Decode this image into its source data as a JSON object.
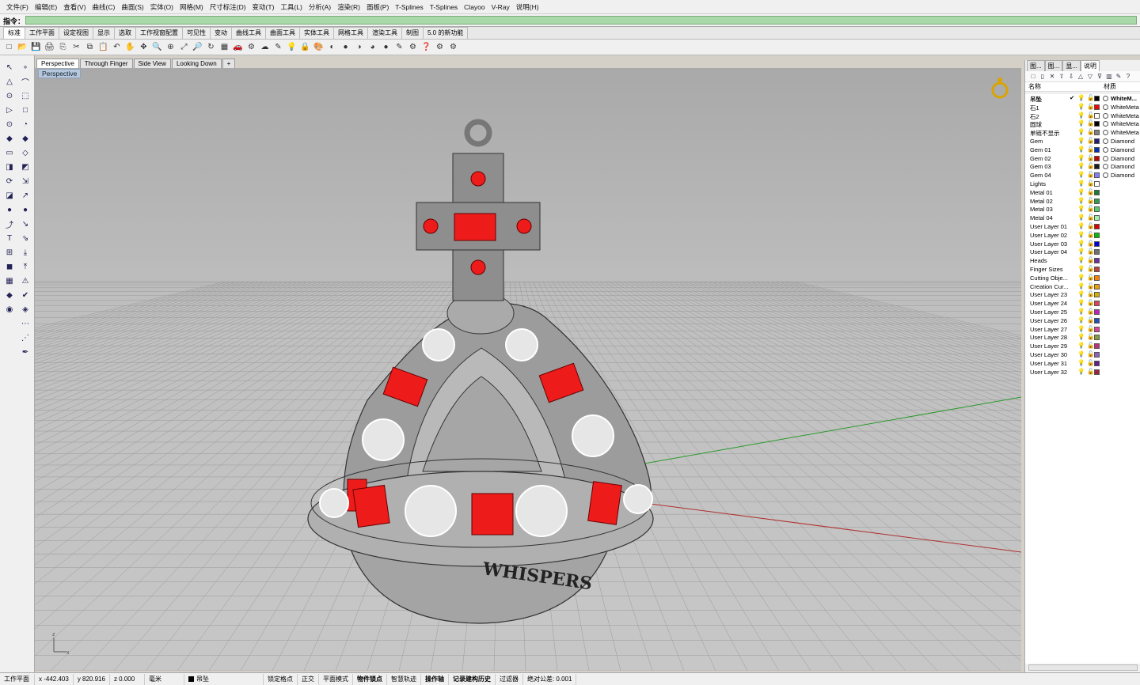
{
  "menu": [
    "文件(F)",
    "编辑(E)",
    "查看(V)",
    "曲线(C)",
    "曲面(S)",
    "实体(O)",
    "网格(M)",
    "尺寸标注(D)",
    "变动(T)",
    "工具(L)",
    "分析(A)",
    "渲染(R)",
    "面板(P)",
    "T-Splines",
    "T-Splines",
    "Clayoo",
    "V-Ray",
    "说明(H)"
  ],
  "command": {
    "label": "指令："
  },
  "toolbar_tabs": [
    "标准",
    "工作平面",
    "设定视图",
    "显示",
    "选取",
    "工作视窗配置",
    "可见性",
    "变动",
    "曲线工具",
    "曲面工具",
    "实体工具",
    "网格工具",
    "渲染工具",
    "制图",
    "5.0 的新功能"
  ],
  "viewport_tabs": [
    "Perspective",
    "Through Finger",
    "Side View",
    "Looking Down"
  ],
  "viewport": {
    "label": "Perspective",
    "engraving": "WHISPERS"
  },
  "panel_tabs": [
    "图...",
    "图...",
    "显...",
    "说明"
  ],
  "layer_headers": {
    "name": "名称",
    "material": "材质"
  },
  "layers": [
    {
      "name": "吊坠",
      "check": "✔",
      "color": "#000000",
      "material": "WhiteM...",
      "bold": true
    },
    {
      "name": "石1",
      "check": "",
      "color": "#ff0000",
      "material": "WhiteMeta"
    },
    {
      "name": "石2",
      "check": "",
      "color": "#ffffff",
      "material": "WhiteMeta"
    },
    {
      "name": "圆球",
      "check": "",
      "color": "#000000",
      "material": "WhiteMeta"
    },
    {
      "name": "单链不显示",
      "check": "",
      "color": "#808080",
      "material": "WhiteMeta"
    },
    {
      "name": "Gem",
      "check": "",
      "color": "#1f1f7a",
      "material": "Diamond"
    },
    {
      "name": "Gem 01",
      "check": "",
      "color": "#0030c0",
      "material": "Diamond"
    },
    {
      "name": "Gem 02",
      "check": "",
      "color": "#cc0000",
      "material": "Diamond"
    },
    {
      "name": "Gem 03",
      "check": "",
      "color": "#1a1a1a",
      "material": "Diamond"
    },
    {
      "name": "Gem 04",
      "check": "",
      "color": "#8080ff",
      "material": "Diamond"
    },
    {
      "name": "Lights",
      "check": "",
      "color": "#ffffff",
      "material": ""
    },
    {
      "name": "Metal 01",
      "check": "",
      "color": "#1a7a3a",
      "material": ""
    },
    {
      "name": "Metal 02",
      "check": "",
      "color": "#2e9e4e",
      "material": ""
    },
    {
      "name": "Metal 03",
      "check": "",
      "color": "#4fcf6f",
      "material": ""
    },
    {
      "name": "Metal 04",
      "check": "",
      "color": "#a0f0b0",
      "material": ""
    },
    {
      "name": "User Layer 01",
      "check": "",
      "color": "#e00000",
      "material": ""
    },
    {
      "name": "User Layer 02",
      "check": "",
      "color": "#00c000",
      "material": ""
    },
    {
      "name": "User Layer 03",
      "check": "",
      "color": "#0000e0",
      "material": ""
    },
    {
      "name": "User Layer 04",
      "check": "",
      "color": "#707070",
      "material": ""
    },
    {
      "name": "Heads",
      "check": "",
      "color": "#7030a0",
      "material": ""
    },
    {
      "name": "Finger Sizes",
      "check": "",
      "color": "#c04040",
      "material": ""
    },
    {
      "name": "Cutting Obje...",
      "check": "",
      "color": "#ff8000",
      "material": ""
    },
    {
      "name": "Creation Cur...",
      "check": "",
      "color": "#f0a000",
      "material": ""
    },
    {
      "name": "User Layer 23",
      "check": "",
      "color": "#d0b000",
      "material": ""
    },
    {
      "name": "User Layer 24",
      "check": "",
      "color": "#e04060",
      "material": ""
    },
    {
      "name": "User Layer 25",
      "check": "",
      "color": "#c020c0",
      "material": ""
    },
    {
      "name": "User Layer 26",
      "check": "",
      "color": "#2050c0",
      "material": ""
    },
    {
      "name": "User Layer 27",
      "check": "",
      "color": "#e040a0",
      "material": ""
    },
    {
      "name": "User Layer 28",
      "check": "",
      "color": "#80a040",
      "material": ""
    },
    {
      "name": "User Layer 29",
      "check": "",
      "color": "#c03080",
      "material": ""
    },
    {
      "name": "User Layer 30",
      "check": "",
      "color": "#9060c0",
      "material": ""
    },
    {
      "name": "User Layer 31",
      "check": "",
      "color": "#602090",
      "material": ""
    },
    {
      "name": "User Layer 32",
      "check": "",
      "color": "#a02040",
      "material": ""
    }
  ],
  "status": {
    "cplane": "工作平面",
    "x": "x -442.403",
    "y": "y 820.916",
    "z": "z 0.000",
    "units": "毫米",
    "layer": "吊坠",
    "toggles": [
      "锁定格点",
      "正交",
      "平面模式",
      "物件锁点",
      "智慧轨迹",
      "操作轴",
      "记录建构历史",
      "过滤器"
    ],
    "tolerance": "绝对公差: 0.001"
  }
}
